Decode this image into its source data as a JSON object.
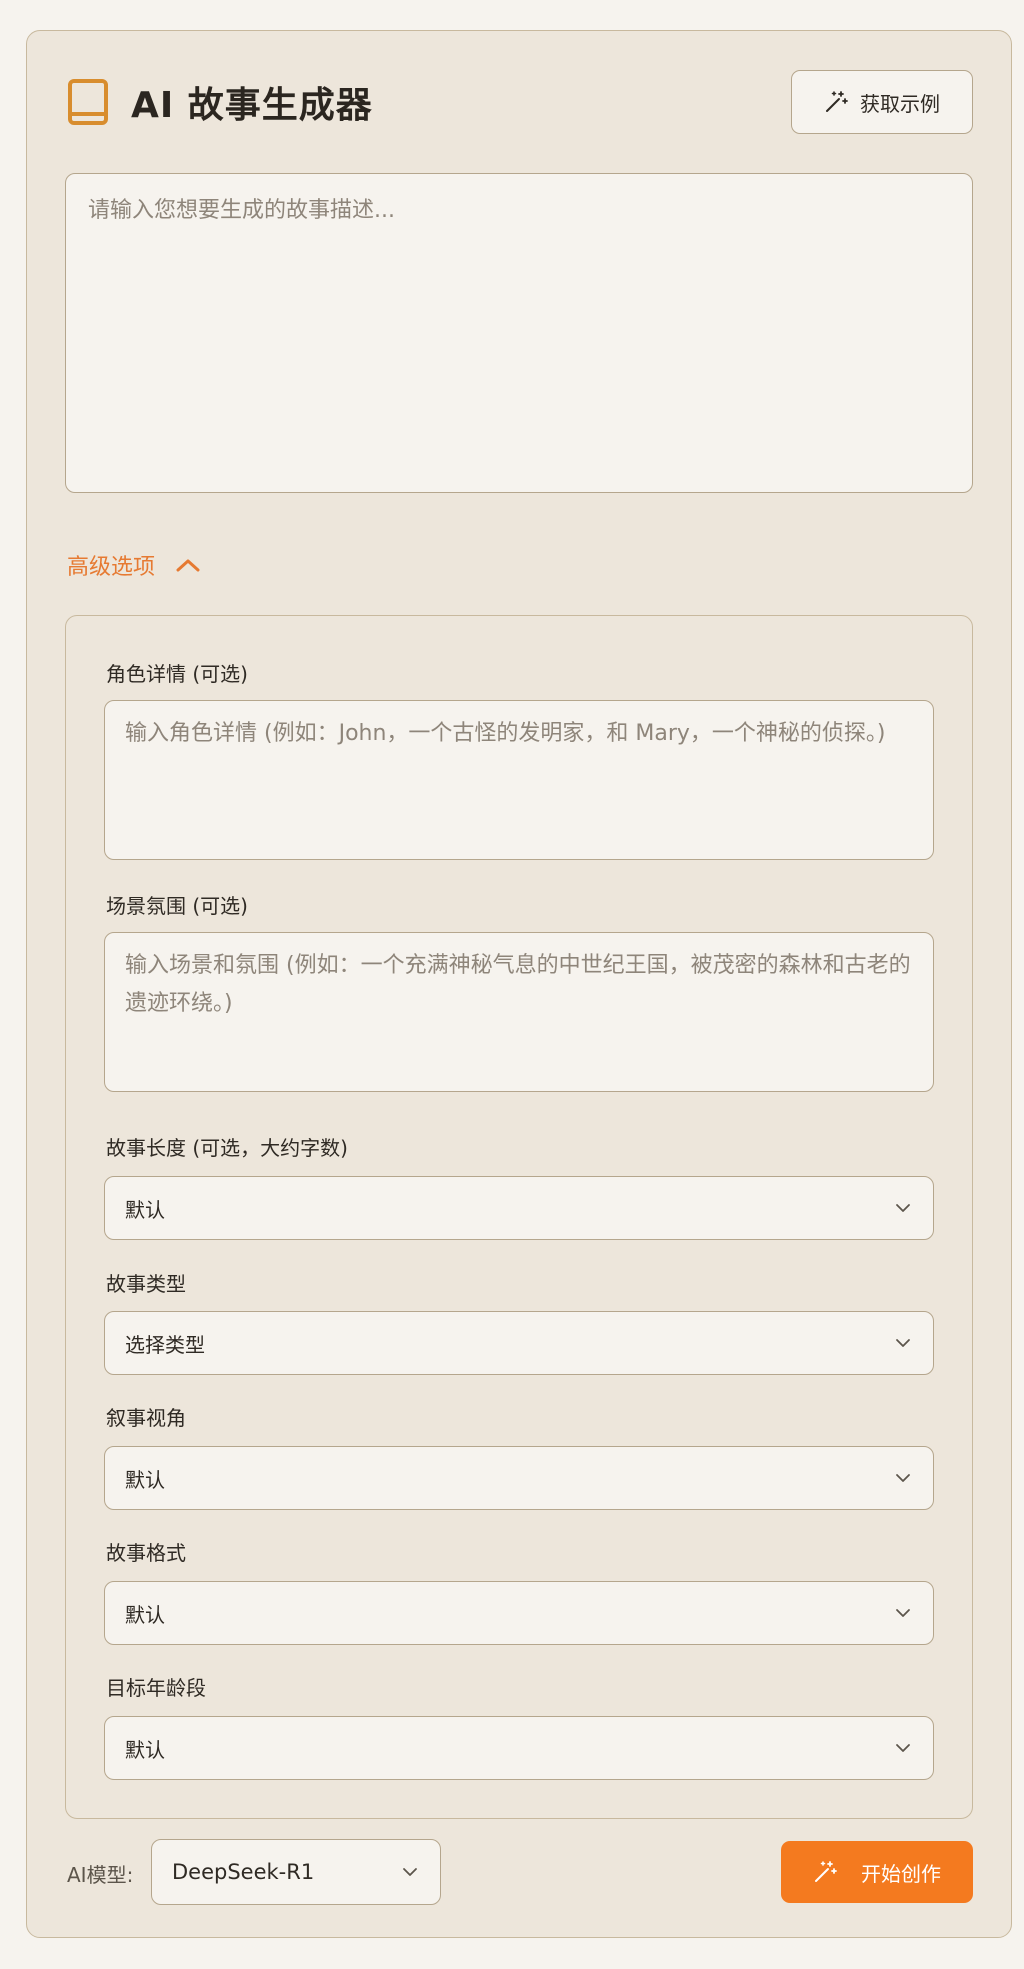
{
  "app": {
    "title": "AI 故事生成器",
    "icon": "book-icon",
    "accent_color": "#f47a1f"
  },
  "header": {
    "example_button_label": "获取示例",
    "example_button_icon": "magic-wand-icon"
  },
  "description": {
    "value": "",
    "placeholder": "请输入您想要生成的故事描述..."
  },
  "advanced": {
    "toggle_label": "高级选项",
    "expanded": true,
    "characters": {
      "label": "角色详情 (可选)",
      "value": "",
      "placeholder": "输入角色详情 (例如：John，一个古怪的发明家，和 Mary，一个神秘的侦探。)"
    },
    "setting": {
      "label": "场景氛围 (可选)",
      "value": "",
      "placeholder": "输入场景和氛围 (例如：一个充满神秘气息的中世纪王国，被茂密的森林和古老的遗迹环绕。)"
    },
    "length": {
      "label": "故事长度 (可选，大约字数)",
      "selected": "默认"
    },
    "genre": {
      "label": "故事类型",
      "selected": "选择类型"
    },
    "perspective": {
      "label": "叙事视角",
      "selected": "默认"
    },
    "format": {
      "label": "故事格式",
      "selected": "默认"
    },
    "age_group": {
      "label": "目标年龄段",
      "selected": "默认"
    }
  },
  "footer": {
    "model_label": "AI模型:",
    "model_selected": "DeepSeek-R1",
    "create_button_label": "开始创作",
    "create_button_icon": "magic-wand-icon"
  }
}
